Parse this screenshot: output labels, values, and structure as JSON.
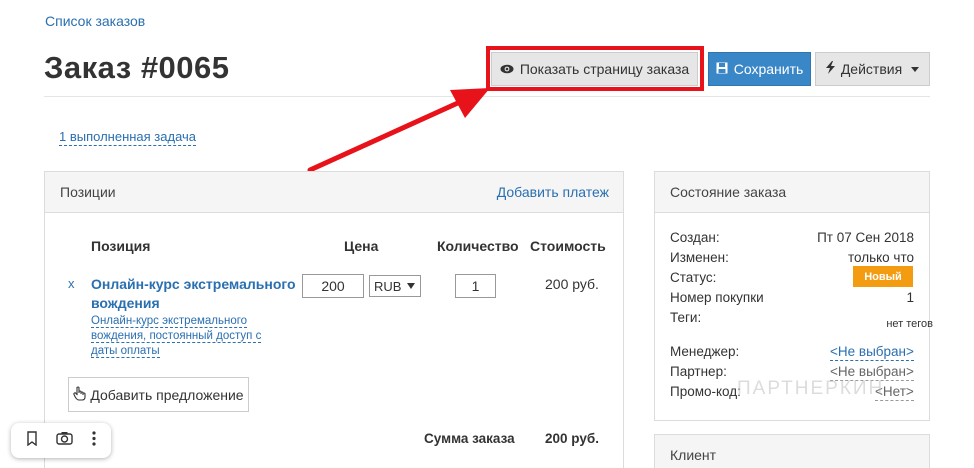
{
  "breadcrumb": "Список заказов",
  "page_title": "Заказ #0065",
  "toolbar": {
    "show_page": "Показать страницу заказа",
    "save": "Сохранить",
    "actions": "Действия"
  },
  "tasks_link": "1 выполненная задача",
  "positions_panel": {
    "title": "Позиции",
    "add_payment": "Добавить платеж",
    "columns": [
      "Позиция",
      "Цена",
      "Количество",
      "Стоимость"
    ],
    "item": {
      "remove": "x",
      "name": "Онлайн-курс экстремального вождения",
      "description": "Онлайн-курс экстремального вождения, постоянный доступ с даты оплаты",
      "price": "200",
      "currency": "RUB",
      "quantity": "1",
      "cost": "200 руб."
    },
    "add_offer": "Добавить предложение",
    "total_label": "Сумма заказа",
    "total_value": "200 руб."
  },
  "state_panel": {
    "title": "Состояние заказа",
    "created_label": "Создан:",
    "created_value": "Пт 07 Сен 2018",
    "changed_label": "Изменен:",
    "changed_value": "только что",
    "status_label": "Статус:",
    "status_value": "Новый",
    "purchase_label": "Номер покупки",
    "purchase_value": "1",
    "tags_label": "Теги:",
    "tags_value": "нет тегов",
    "manager_label": "Менеджер:",
    "manager_value": "<Не выбран>",
    "partner_label": "Партнер:",
    "partner_value": "<Не выбран>",
    "promo_label": "Промо-код:",
    "promo_value": "<Нет>"
  },
  "client_panel": {
    "title": "Клиент"
  },
  "watermark": "ПАРТНЕРКИН",
  "colors": {
    "link": "#2a6fb0",
    "save_button": "#3a87c8",
    "status_badge": "#f39c12",
    "highlight": "#e8121a"
  }
}
